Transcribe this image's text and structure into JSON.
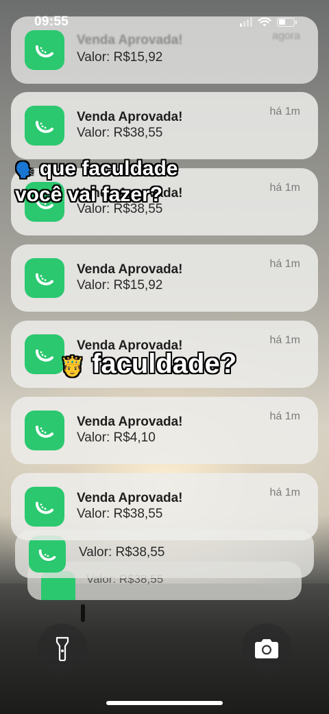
{
  "status_bar": {
    "time": "09:55"
  },
  "notifications": [
    {
      "title": "Venda Aprovada!",
      "value": "Valor: R$15,92",
      "ago": "agora"
    },
    {
      "title": "Venda Aprovada!",
      "value": "Valor: R$38,55",
      "ago": "há 1m"
    },
    {
      "title": "Venda Aprovada!",
      "value": "Valor: R$38,55",
      "ago": "há 1m"
    },
    {
      "title": "Venda Aprovada!",
      "value": "Valor: R$15,92",
      "ago": "há 1m"
    },
    {
      "title": "Venda Aprovada!",
      "value": "",
      "ago": "há 1m"
    },
    {
      "title": "Venda Aprovada!",
      "value": "Valor: R$4,10",
      "ago": "há 1m"
    },
    {
      "title": "Venda Aprovada!",
      "value": "Valor: R$38,55",
      "ago": "há 1m"
    }
  ],
  "stacked": [
    {
      "value": "Valor: R$38,55"
    },
    {
      "value": "Valor: R$38,55"
    }
  ],
  "captions": {
    "line1": "que faculdade",
    "line2": "você vai fazer?",
    "line3": "faculdade?"
  },
  "icons": {
    "app": "melon-slice-icon",
    "flashlight": "flashlight-icon",
    "camera": "camera-icon",
    "speaking": "speaking-head-icon",
    "crown_person": "person-crown-icon"
  },
  "colors": {
    "app_green": "#2bc86f"
  }
}
